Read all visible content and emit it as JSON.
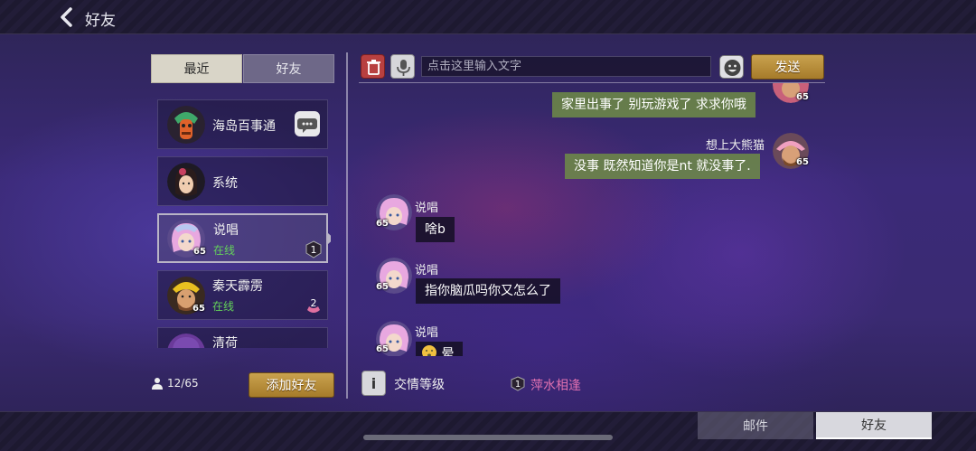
{
  "header": {
    "title": "好友"
  },
  "left_panel": {
    "tabs": [
      {
        "label": "最近",
        "active": true
      },
      {
        "label": "好友",
        "active": false
      }
    ],
    "friends": [
      {
        "name": "海岛百事通",
        "status": "",
        "level": "",
        "badge": ""
      },
      {
        "name": "系统",
        "status": "",
        "level": "",
        "badge": ""
      },
      {
        "name": "说唱",
        "status": "在线",
        "level": "65",
        "badge": "1"
      },
      {
        "name": "秦天霹雳",
        "status": "在线",
        "level": "65",
        "badge": "2"
      },
      {
        "name": "清荷",
        "status": "",
        "level": "",
        "badge": ""
      }
    ],
    "friend_count": "12/65",
    "add_friend_label": "添加好友"
  },
  "chat": {
    "input_placeholder": "点击这里输入文字",
    "send_label": "发送",
    "messages": [
      {
        "side": "mine",
        "sender": "",
        "text": "家里出事了 别玩游戏了 求求你哦",
        "level": "65"
      },
      {
        "side": "mine",
        "sender": "想上大熊猫",
        "text": "没事 既然知道你是nt 就没事了.",
        "level": "65"
      },
      {
        "side": "theirs",
        "sender": "说唱",
        "text": "啥b",
        "level": "65"
      },
      {
        "side": "theirs",
        "sender": "说唱",
        "text": "指你脑瓜吗你又怎么了",
        "level": "65"
      },
      {
        "side": "theirs",
        "sender": "说唱",
        "text": "晕",
        "level": "65"
      }
    ],
    "intimacy_icon": "i",
    "intimacy_label": "交情等级",
    "relation_level": "1",
    "relation_label": "萍水相逢"
  },
  "bottom_tabs": [
    {
      "label": "邮件",
      "active": false
    },
    {
      "label": "好友",
      "active": true
    }
  ],
  "colors": {
    "online": "#64d25a",
    "gold_button": "#c9a24e",
    "relation": "#e070b0",
    "my_bubble": "#6e8c46"
  }
}
